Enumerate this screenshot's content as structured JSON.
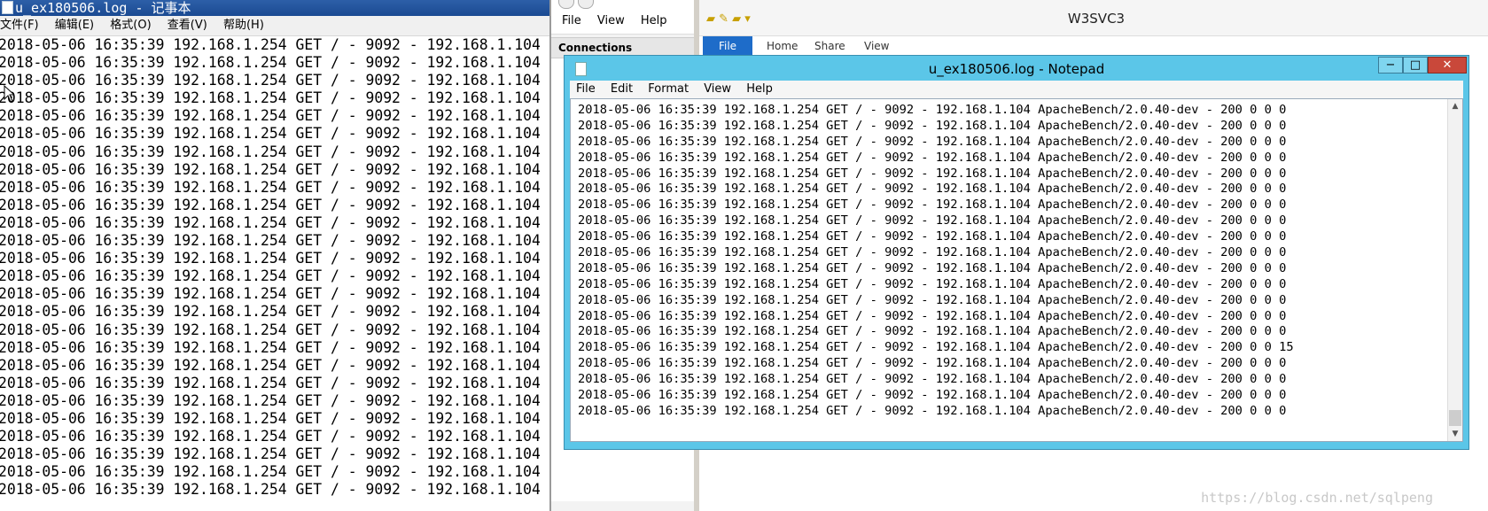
{
  "left_notepad": {
    "title": "u_ex180506.log - 记事本",
    "menu": [
      "文件(F)",
      "编辑(E)",
      "格式(O)",
      "查看(V)",
      "帮助(H)"
    ],
    "line_text": "2018-05-06 16:35:39 192.168.1.254 GET / - 9092 - 192.168.1.104",
    "line_count": 26
  },
  "iis": {
    "menu": [
      "File",
      "View",
      "Help"
    ],
    "connections_label": "Connections"
  },
  "explorer": {
    "title": "W3SVC3",
    "tabs": [
      "File",
      "Home",
      "Share",
      "View"
    ]
  },
  "notepad": {
    "title": "u_ex180506.log - Notepad",
    "buttons": {
      "minimize": "−",
      "maximize": "□",
      "close": "✕"
    },
    "menu": [
      "File",
      "Edit",
      "Format",
      "View",
      "Help"
    ],
    "lines": [
      "2018-05-06 16:35:39 192.168.1.254 GET / - 9092 - 192.168.1.104 ApacheBench/2.0.40-dev - 200 0 0 0",
      "2018-05-06 16:35:39 192.168.1.254 GET / - 9092 - 192.168.1.104 ApacheBench/2.0.40-dev - 200 0 0 0",
      "2018-05-06 16:35:39 192.168.1.254 GET / - 9092 - 192.168.1.104 ApacheBench/2.0.40-dev - 200 0 0 0",
      "2018-05-06 16:35:39 192.168.1.254 GET / - 9092 - 192.168.1.104 ApacheBench/2.0.40-dev - 200 0 0 0",
      "2018-05-06 16:35:39 192.168.1.254 GET / - 9092 - 192.168.1.104 ApacheBench/2.0.40-dev - 200 0 0 0",
      "2018-05-06 16:35:39 192.168.1.254 GET / - 9092 - 192.168.1.104 ApacheBench/2.0.40-dev - 200 0 0 0",
      "2018-05-06 16:35:39 192.168.1.254 GET / - 9092 - 192.168.1.104 ApacheBench/2.0.40-dev - 200 0 0 0",
      "2018-05-06 16:35:39 192.168.1.254 GET / - 9092 - 192.168.1.104 ApacheBench/2.0.40-dev - 200 0 0 0",
      "2018-05-06 16:35:39 192.168.1.254 GET / - 9092 - 192.168.1.104 ApacheBench/2.0.40-dev - 200 0 0 0",
      "2018-05-06 16:35:39 192.168.1.254 GET / - 9092 - 192.168.1.104 ApacheBench/2.0.40-dev - 200 0 0 0",
      "2018-05-06 16:35:39 192.168.1.254 GET / - 9092 - 192.168.1.104 ApacheBench/2.0.40-dev - 200 0 0 0",
      "2018-05-06 16:35:39 192.168.1.254 GET / - 9092 - 192.168.1.104 ApacheBench/2.0.40-dev - 200 0 0 0",
      "2018-05-06 16:35:39 192.168.1.254 GET / - 9092 - 192.168.1.104 ApacheBench/2.0.40-dev - 200 0 0 0",
      "2018-05-06 16:35:39 192.168.1.254 GET / - 9092 - 192.168.1.104 ApacheBench/2.0.40-dev - 200 0 0 0",
      "2018-05-06 16:35:39 192.168.1.254 GET / - 9092 - 192.168.1.104 ApacheBench/2.0.40-dev - 200 0 0 0",
      "2018-05-06 16:35:39 192.168.1.254 GET / - 9092 - 192.168.1.104 ApacheBench/2.0.40-dev - 200 0 0 15",
      "2018-05-06 16:35:39 192.168.1.254 GET / - 9092 - 192.168.1.104 ApacheBench/2.0.40-dev - 200 0 0 0",
      "2018-05-06 16:35:39 192.168.1.254 GET / - 9092 - 192.168.1.104 ApacheBench/2.0.40-dev - 200 0 0 0",
      "2018-05-06 16:35:39 192.168.1.254 GET / - 9092 - 192.168.1.104 ApacheBench/2.0.40-dev - 200 0 0 0",
      "2018-05-06 16:35:39 192.168.1.254 GET / - 9092 - 192.168.1.104 ApacheBench/2.0.40-dev - 200 0 0 0"
    ]
  },
  "watermark": "https://blog.csdn.net/sqlpeng",
  "colors": {
    "notepad_frame": "#5bc6e8",
    "close_button": "#c9483a",
    "explorer_file_tab": "#1e6cc9",
    "left_titlebar": "#1a4a92"
  }
}
